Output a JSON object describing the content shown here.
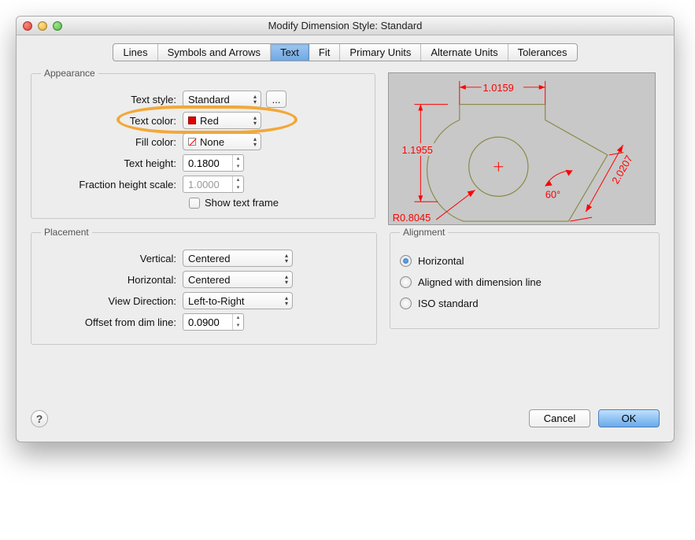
{
  "window": {
    "title": "Modify Dimension Style: Standard"
  },
  "tabs": [
    "Lines",
    "Symbols and Arrows",
    "Text",
    "Fit",
    "Primary Units",
    "Alternate Units",
    "Tolerances"
  ],
  "active_tab": "Text",
  "sections": {
    "appearance": "Appearance",
    "placement": "Placement",
    "alignment": "Alignment"
  },
  "appearance": {
    "text_style_label": "Text style:",
    "text_style_value": "Standard",
    "text_color_label": "Text color:",
    "text_color_value": "Red",
    "fill_color_label": "Fill color:",
    "fill_color_value": "None",
    "text_height_label": "Text height:",
    "text_height_value": "0.1800",
    "fraction_scale_label": "Fraction height scale:",
    "fraction_scale_value": "1.0000",
    "show_text_frame_label": "Show text frame"
  },
  "placement": {
    "vertical_label": "Vertical:",
    "vertical_value": "Centered",
    "horizontal_label": "Horizontal:",
    "horizontal_value": "Centered",
    "view_direction_label": "View Direction:",
    "view_direction_value": "Left-to-Right",
    "offset_label": "Offset from dim line:",
    "offset_value": "0.0900"
  },
  "alignment": {
    "horizontal": "Horizontal",
    "aligned": "Aligned with dimension line",
    "iso": "ISO standard"
  },
  "preview": {
    "dim_top": "1.0159",
    "dim_left": "1.1955",
    "dim_diag": "2.0207",
    "dim_angle": "60°",
    "dim_radius": "R0.8045"
  },
  "footer": {
    "cancel": "Cancel",
    "ok": "OK"
  }
}
